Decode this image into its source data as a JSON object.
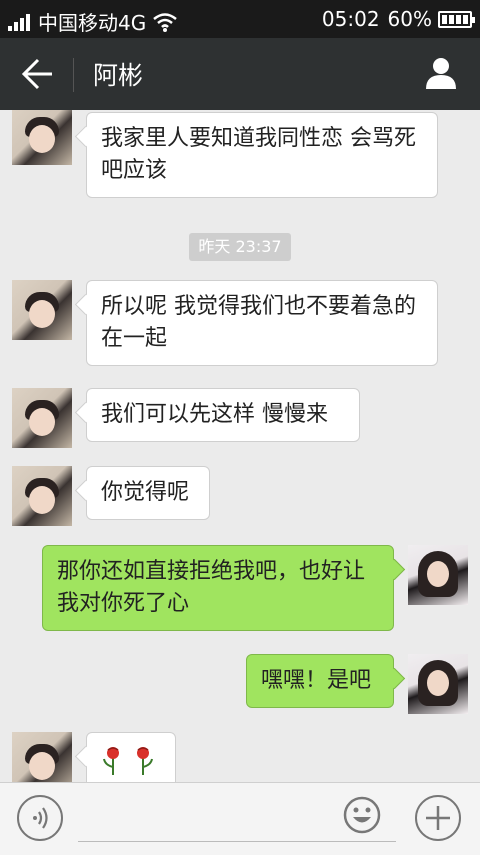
{
  "status_bar": {
    "carrier": "中国移动4G",
    "time": "05:02",
    "battery": "60%"
  },
  "header": {
    "title": "阿彬"
  },
  "messages": [
    {
      "side": "left",
      "text": "我家里人要知道我同性恋 会骂死吧应该"
    },
    {
      "side": "left",
      "text": "所以呢 我觉得我们也不要着急的在一起"
    },
    {
      "side": "left",
      "text": "我们可以先这样 慢慢来"
    },
    {
      "side": "left",
      "text": "你觉得呢"
    },
    {
      "side": "right",
      "text": "那你还如直接拒绝我吧，也好让我对你死了心"
    },
    {
      "side": "right",
      "text": "嘿嘿！是吧"
    },
    {
      "side": "left",
      "text": "",
      "icons": [
        "rose-icon",
        "rose-icon"
      ]
    }
  ],
  "timestamp": "昨天 23:37",
  "icons": {
    "back": "back-arrow-icon",
    "contact": "person-icon",
    "voice": "voice-icon",
    "emoji": "emoji-icon",
    "more": "plus-icon"
  },
  "colors": {
    "header_bg": "#2e3132",
    "chat_bg": "#ebebeb",
    "sent_bubble": "#a0e45f",
    "received_bubble": "#ffffff"
  }
}
